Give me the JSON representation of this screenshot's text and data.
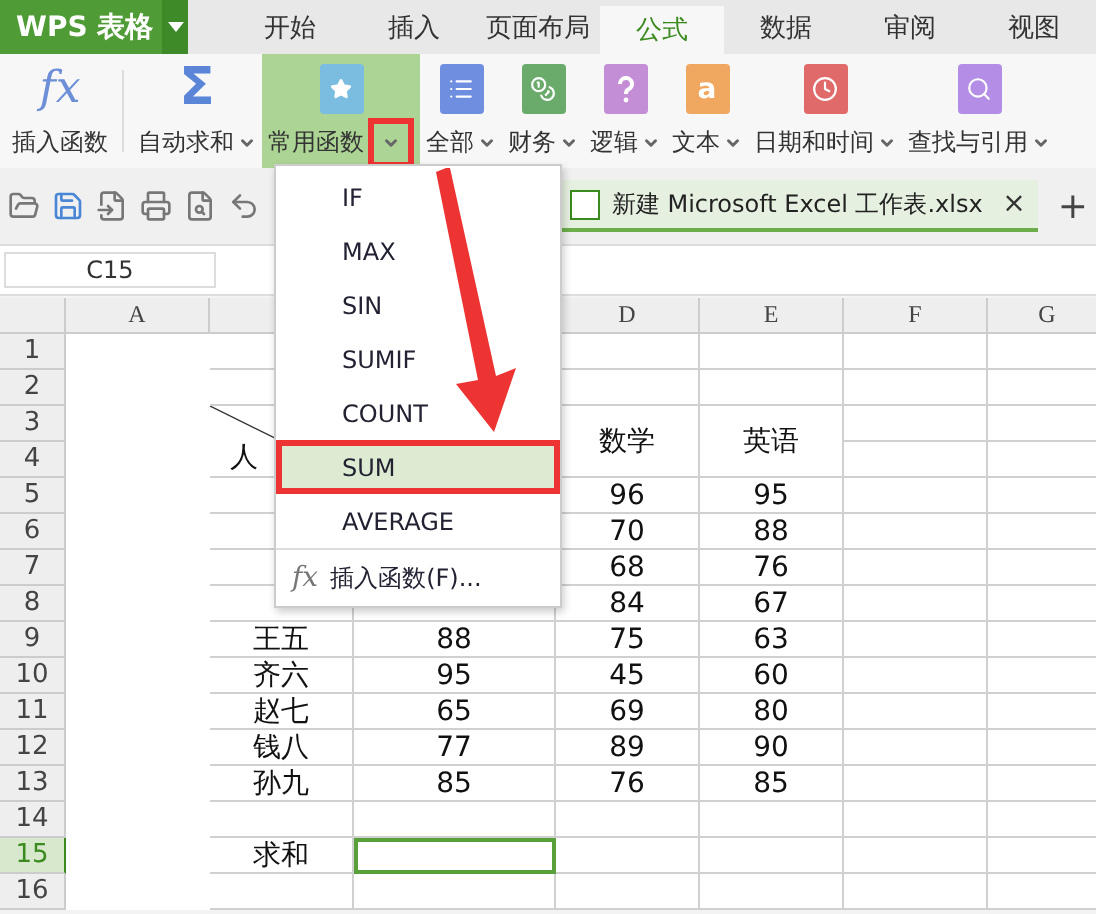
{
  "app": {
    "logo": "WPS 表格"
  },
  "tabs": [
    {
      "label": "开始",
      "selected": false
    },
    {
      "label": "插入",
      "selected": false
    },
    {
      "label": "页面布局",
      "selected": false
    },
    {
      "label": "公式",
      "selected": true
    },
    {
      "label": "数据",
      "selected": false
    },
    {
      "label": "审阅",
      "selected": false
    },
    {
      "label": "视图",
      "selected": false
    }
  ],
  "ribbon": [
    {
      "label": "插入函数",
      "kind": "fx",
      "glyph": "fx",
      "dropdown": false,
      "selected": false
    },
    {
      "label": "自动求和",
      "kind": "sigma",
      "glyph": "Σ",
      "dropdown": true,
      "selected": false
    },
    {
      "label": "常用函数",
      "kind": "star",
      "dropdown": true,
      "selected": true
    },
    {
      "label": "全部",
      "kind": "list",
      "dropdown": true,
      "selected": false
    },
    {
      "label": "财务",
      "kind": "coins",
      "dropdown": true,
      "selected": false
    },
    {
      "label": "逻辑",
      "kind": "question",
      "dropdown": true,
      "selected": false
    },
    {
      "label": "文本",
      "kind": "text",
      "glyph": "a",
      "dropdown": true,
      "selected": false
    },
    {
      "label": "日期和时间",
      "kind": "clock",
      "dropdown": true,
      "selected": false
    },
    {
      "label": "查找与引用",
      "kind": "search",
      "dropdown": true,
      "selected": false
    }
  ],
  "document_tab": {
    "title": "新建 Microsoft Excel 工作表.xlsx",
    "close": "×",
    "add": "+"
  },
  "name_box": "C15",
  "column_headers": [
    {
      "label": "A"
    },
    {
      "covered": true
    },
    {
      "label": "D"
    },
    {
      "label": "E"
    },
    {
      "label": "F"
    },
    {
      "label": "G"
    }
  ],
  "rows": [
    {
      "label": "1",
      "selected": false,
      "cells": [
        null,
        {
          "covered": true
        },
        null,
        null,
        null,
        null
      ]
    },
    {
      "label": "2",
      "selected": false,
      "cells": [
        null,
        {
          "covered": true
        },
        null,
        null,
        null,
        null
      ]
    },
    {
      "label": "3",
      "selected": false,
      "cells": [
        {
          "text": "人",
          "diagonal": true,
          "merged_below": true
        },
        {
          "covered": true
        },
        {
          "text": "数学",
          "merged_below": true
        },
        {
          "text": "英语",
          "merged_below": true
        },
        null,
        null
      ]
    },
    {
      "label": "4",
      "selected": false,
      "cells": [
        null,
        null,
        null,
        null,
        null,
        null
      ]
    },
    {
      "label": "5",
      "selected": false,
      "cells": [
        null,
        null,
        {
          "text": "96"
        },
        {
          "text": "95"
        },
        null,
        null
      ]
    },
    {
      "label": "6",
      "selected": false,
      "cells": [
        null,
        null,
        {
          "text": "70"
        },
        {
          "text": "88"
        },
        null,
        null
      ]
    },
    {
      "label": "7",
      "selected": false,
      "cells": [
        null,
        null,
        {
          "text": "68"
        },
        {
          "text": "76"
        },
        null,
        null
      ]
    },
    {
      "label": "8",
      "selected": false,
      "cells": [
        null,
        null,
        {
          "text": "84"
        },
        {
          "text": "67"
        },
        null,
        null
      ]
    },
    {
      "label": "9",
      "selected": false,
      "cells": [
        {
          "text": "王五"
        },
        {
          "text": "88"
        },
        {
          "text": "75"
        },
        {
          "text": "63"
        },
        null,
        null
      ]
    },
    {
      "label": "10",
      "selected": false,
      "cells": [
        {
          "text": "齐六"
        },
        {
          "text": "95"
        },
        {
          "text": "45"
        },
        {
          "text": "60"
        },
        null,
        null
      ]
    },
    {
      "label": "11",
      "selected": false,
      "cells": [
        {
          "text": "赵七"
        },
        {
          "text": "65"
        },
        {
          "text": "69"
        },
        {
          "text": "80"
        },
        null,
        null
      ]
    },
    {
      "label": "12",
      "selected": false,
      "cells": [
        {
          "text": "钱八"
        },
        {
          "text": "77"
        },
        {
          "text": "89"
        },
        {
          "text": "90"
        },
        null,
        null
      ]
    },
    {
      "label": "13",
      "selected": false,
      "cells": [
        {
          "text": "孙九"
        },
        {
          "text": "85"
        },
        {
          "text": "76"
        },
        {
          "text": "85"
        },
        null,
        null
      ]
    },
    {
      "label": "14",
      "selected": false,
      "cells": [
        null,
        null,
        null,
        null,
        null,
        null
      ]
    },
    {
      "label": "15",
      "selected": true,
      "cells": [
        {
          "text": "求和"
        },
        {
          "selected": true
        },
        null,
        null,
        null,
        null
      ]
    },
    {
      "label": "16",
      "selected": false,
      "cells": [
        null,
        null,
        null,
        null,
        null,
        null
      ]
    }
  ],
  "menu": {
    "items": [
      {
        "label": "IF",
        "kind": "function",
        "selected": false
      },
      {
        "label": "MAX",
        "kind": "function",
        "selected": false
      },
      {
        "label": "SIN",
        "kind": "function",
        "selected": false
      },
      {
        "label": "SUMIF",
        "kind": "function",
        "selected": false
      },
      {
        "label": "COUNT",
        "kind": "function",
        "selected": false
      },
      {
        "label": "SUM",
        "kind": "function",
        "selected": true
      },
      {
        "label": "AVERAGE",
        "kind": "function",
        "selected": false
      },
      {
        "label": "插入函数(F)...",
        "kind": "insert",
        "glyph": "fx",
        "selected": false
      }
    ]
  }
}
